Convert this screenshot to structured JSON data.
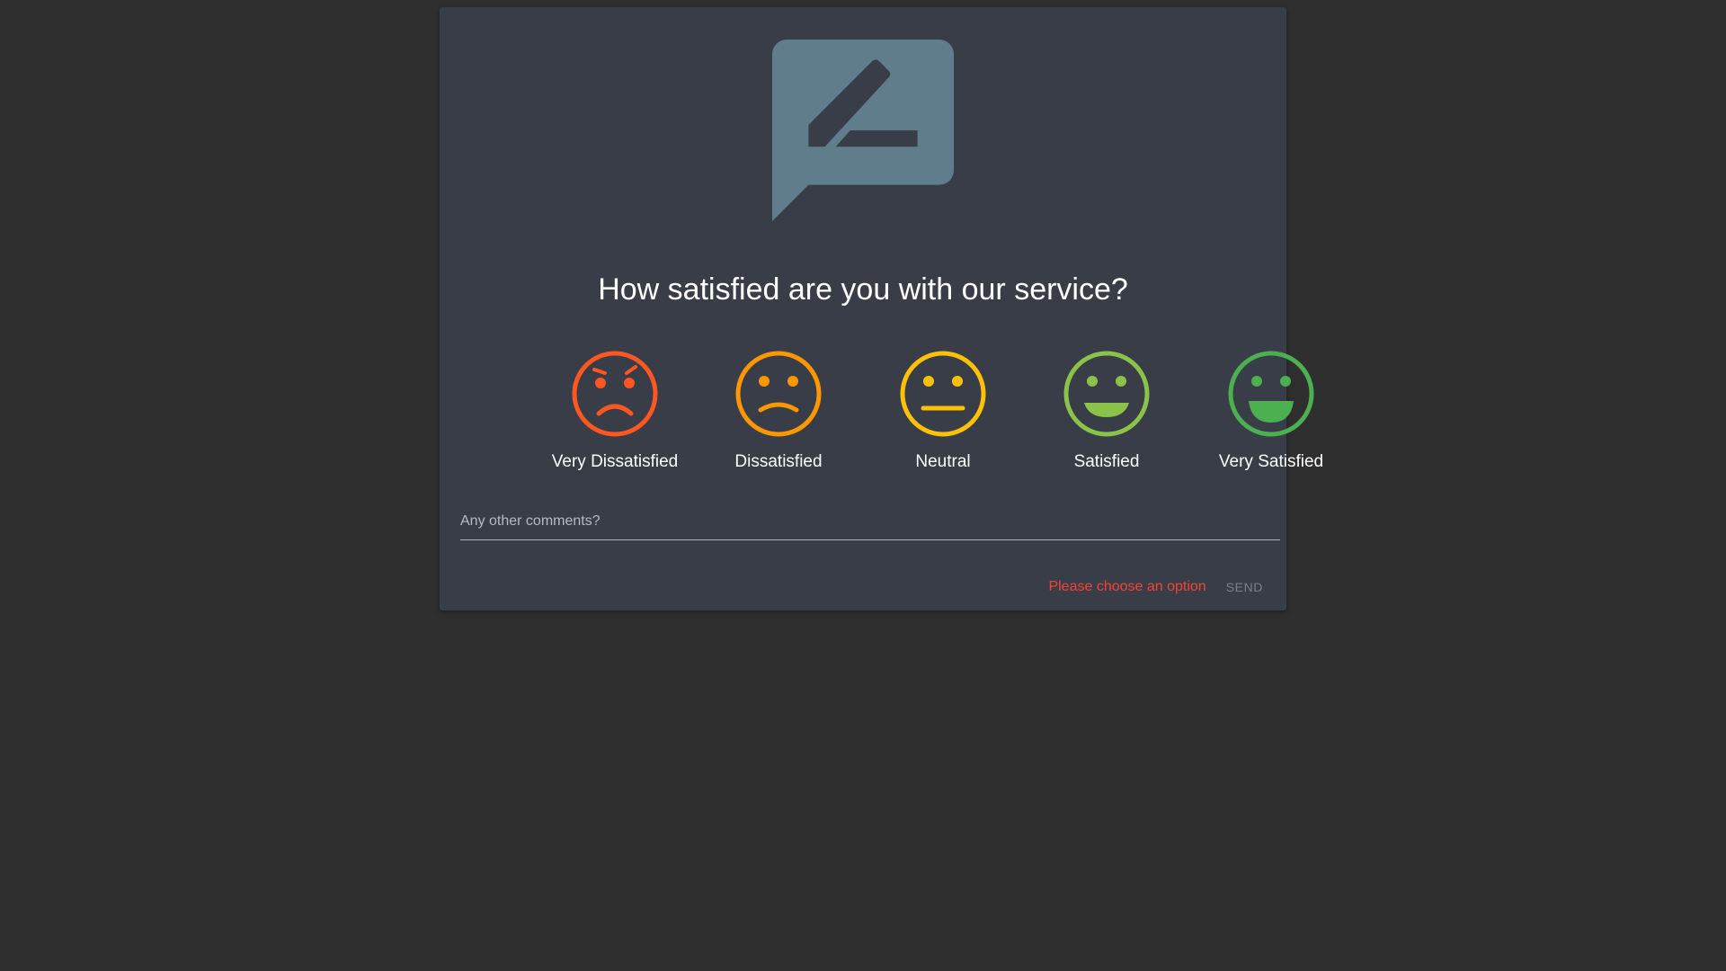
{
  "dialog": {
    "question": "How satisfied are you with our service?",
    "header_icon": "feedback-pencil-icon",
    "icon_color": "#607d8b"
  },
  "options": [
    {
      "label": "Very Dissatisfied",
      "icon": "very-dissatisfied-face-icon",
      "color": "#ff5722"
    },
    {
      "label": "Dissatisfied",
      "icon": "dissatisfied-face-icon",
      "color": "#ff9800"
    },
    {
      "label": "Neutral",
      "icon": "neutral-face-icon",
      "color": "#ffc107"
    },
    {
      "label": "Satisfied",
      "icon": "satisfied-face-icon",
      "color": "#8bc34a"
    },
    {
      "label": "Very Satisfied",
      "icon": "very-satisfied-face-icon",
      "color": "#4caf50"
    }
  ],
  "comments": {
    "placeholder": "Any other comments?",
    "value": ""
  },
  "footer": {
    "error": "Please choose an option",
    "send_label": "SEND"
  }
}
